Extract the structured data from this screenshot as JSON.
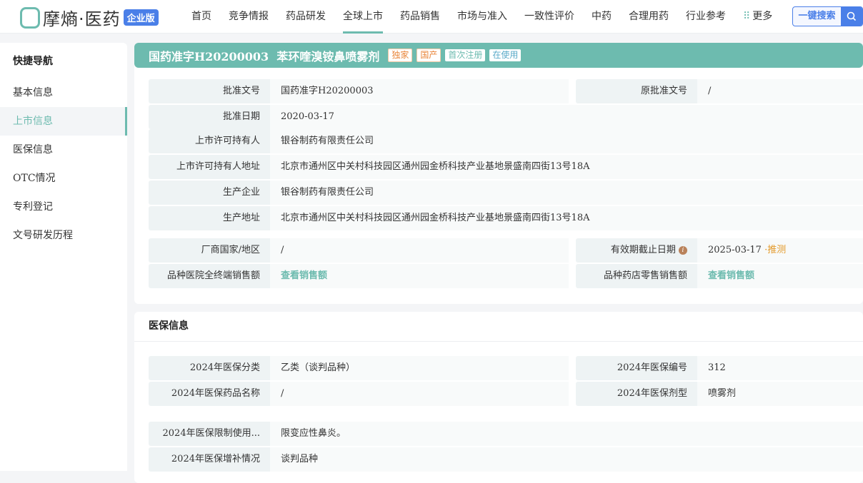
{
  "header": {
    "logo_text": "摩熵·医药",
    "edition": "企业版",
    "nav": [
      "首页",
      "竞争情报",
      "药品研发",
      "全球上市",
      "药品销售",
      "市场与准入",
      "一致性评价",
      "中药",
      "合理用药",
      "行业参考",
      "更多"
    ],
    "active_nav": "全球上市",
    "search_label": "一键搜索"
  },
  "sidebar": {
    "title": "快捷导航",
    "items": [
      "基本信息",
      "上市信息",
      "医保信息",
      "OTC情况",
      "专利登记",
      "文号研发历程"
    ],
    "active": "上市信息"
  },
  "title": {
    "text": "国药准字H20200003  苯环喹溴铵鼻喷雾剂",
    "tags": [
      "独家",
      "国产",
      "首次注册",
      "在使用"
    ]
  },
  "basic": {
    "approval_no": {
      "label": "批准文号",
      "value": "国药准字H20200003"
    },
    "orig_approval_no": {
      "label": "原批准文号",
      "value": "/"
    },
    "approval_date": {
      "label": "批准日期",
      "value": "2020-03-17"
    },
    "holder": {
      "label": "上市许可持有人",
      "value": "银谷制药有限责任公司"
    },
    "holder_addr": {
      "label": "上市许可持有人地址",
      "value": "北京市通州区中关村科技园区通州园金桥科技产业基地景盛南四街13号18A"
    },
    "manufacturer": {
      "label": "生产企业",
      "value": "银谷制药有限责任公司"
    },
    "mfg_addr": {
      "label": "生产地址",
      "value": "北京市通州区中关村科技园区通州园金桥科技产业基地景盛南四街13号18A"
    },
    "country": {
      "label": "厂商国家/地区",
      "value": "/"
    },
    "expiry": {
      "label": "有效期截止日期",
      "value": "2025-03-17",
      "estimate": "·推测"
    },
    "hospital_sales": {
      "label": "品种医院全终端销售额",
      "value": "查看销售额"
    },
    "pharmacy_sales": {
      "label": "品种药店零售销售额",
      "value": "查看销售额"
    }
  },
  "insurance": {
    "title": "医保信息",
    "category": {
      "label": "2024年医保分类",
      "value": "乙类（谈判品种）"
    },
    "code": {
      "label": "2024年医保编号",
      "value": "312"
    },
    "name": {
      "label": "2024年医保药品名称",
      "value": "/"
    },
    "form": {
      "label": "2024年医保剂型",
      "value": "喷雾剂"
    },
    "restriction": {
      "label": "2024年医保限制使用...",
      "value": "限变应性鼻炎。"
    },
    "supplement": {
      "label": "2024年医保增补情况",
      "value": "谈判品种"
    }
  }
}
